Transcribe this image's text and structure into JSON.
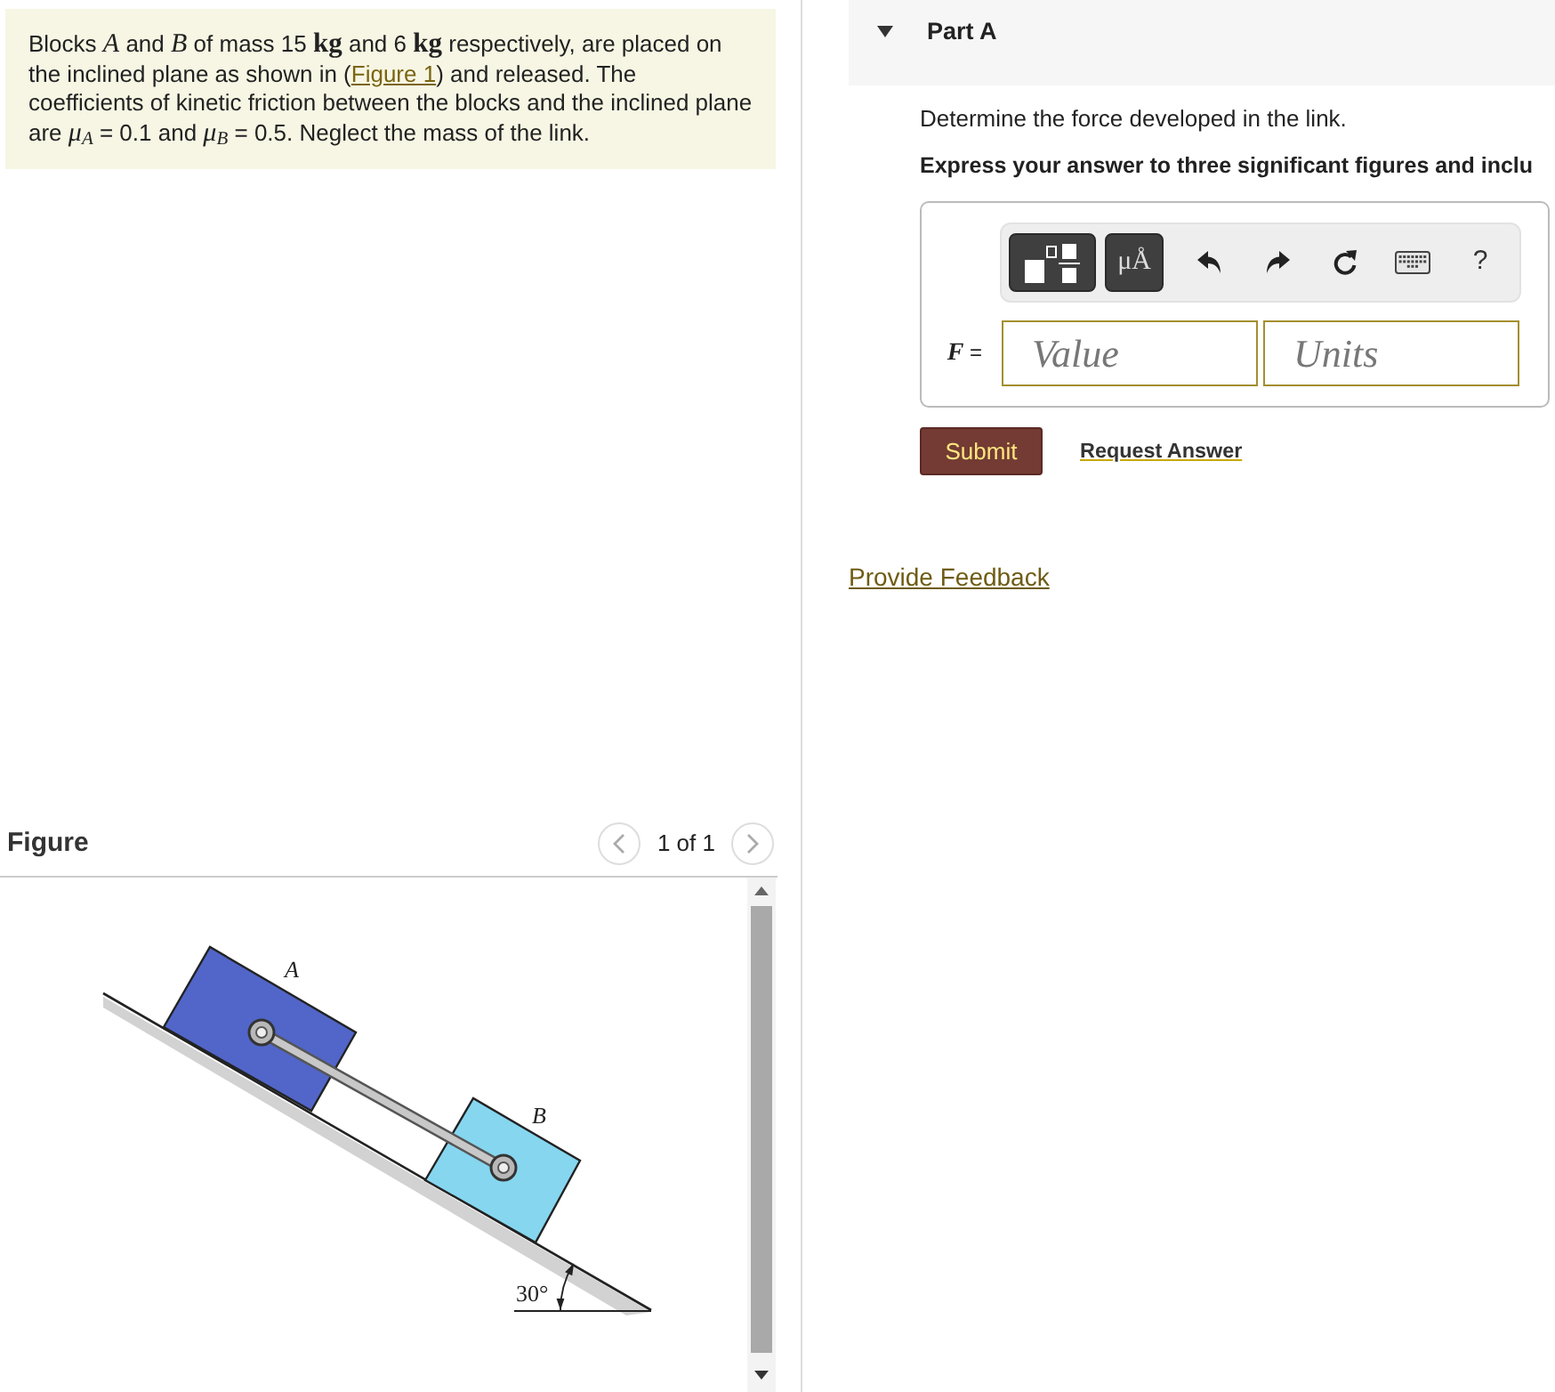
{
  "problem": {
    "parts": [
      {
        "kind": "text",
        "text": "Blocks *A* and *B* of mass 15 **kg** and 6 **kg** respectively, are placed on the inclined plane as shown in ("
      },
      {
        "kind": "link",
        "text": "Figure 1"
      },
      {
        "kind": "text",
        "text": ") and released. The coefficients of kinetic friction between the blocks and the inclined plane are *μ*$_{A}$ = 0.1 and *μ*$_{B}$ = 0.5. Neglect the mass of the link."
      }
    ]
  },
  "figure": {
    "heading": "Figure",
    "pager": "1 of 1",
    "blocks": [
      {
        "label": "A",
        "color": "#5166c8"
      },
      {
        "label": "B",
        "color": "#86d6f0"
      }
    ],
    "angle_label": "30°"
  },
  "part": {
    "title": "Part A",
    "expanded": true,
    "prompt": "Determine the force developed in the link.",
    "instruction": "Express your answer to three significant figures and inclu",
    "toolbar": [
      {
        "kind": "templates"
      },
      {
        "kind": "symbols",
        "label": "μÅ"
      },
      {
        "kind": "undo"
      },
      {
        "kind": "redo"
      },
      {
        "kind": "reset"
      },
      {
        "kind": "keyboard"
      },
      {
        "kind": "help",
        "label": "?"
      }
    ],
    "answer": {
      "label": "*F* =",
      "fields": [
        {
          "placeholder": "Value"
        },
        {
          "placeholder": "Units"
        }
      ]
    },
    "submit": "Submit",
    "request_answer": "Request Answer"
  },
  "feedback_link": "Provide Feedback"
}
